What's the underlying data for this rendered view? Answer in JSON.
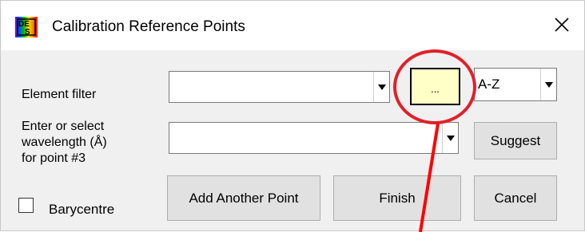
{
  "window": {
    "title": "Calibration Reference Points",
    "close_glyph": "✕"
  },
  "element_filter": {
    "label": "Element filter",
    "value": "",
    "ellipsis_label": "...",
    "sort_value": "A-Z"
  },
  "wavelength": {
    "label_line1": "Enter or select",
    "label_line2": "wavelength (Å)",
    "label_line3": "for point #3",
    "value": "",
    "suggest_label": "Suggest"
  },
  "barycentre": {
    "label": "Barycentre",
    "checked": false
  },
  "buttons": {
    "add_point": "Add Another Point",
    "finish": "Finish",
    "cancel": "Cancel"
  },
  "colors": {
    "highlight_circle": "#e0202a",
    "arrow": "#ff0000",
    "ellipsis_bg": "#ffffc8"
  },
  "icons": {
    "app": "spectrum-app-icon",
    "close": "close-icon",
    "dropdown": "chevron-down-icon"
  }
}
